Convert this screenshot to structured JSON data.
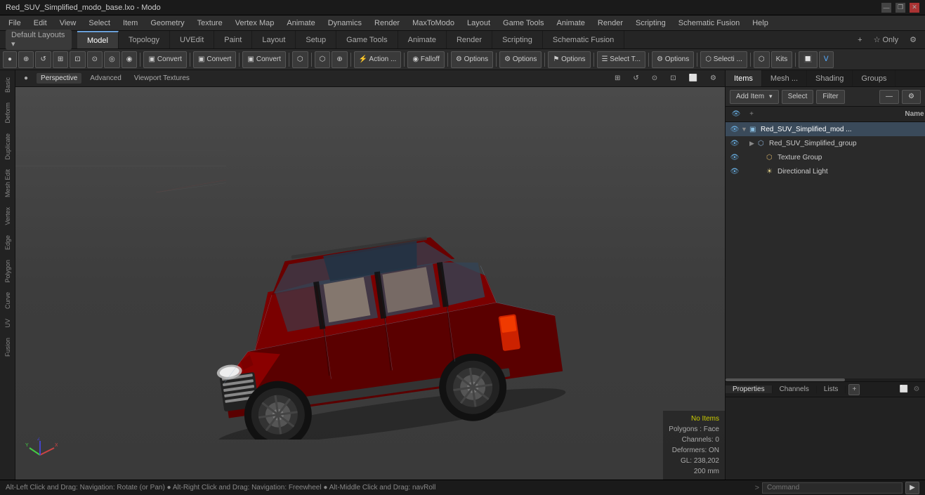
{
  "titlebar": {
    "title": "Red_SUV_Simplified_modo_base.lxo - Modo",
    "controls": [
      "—",
      "❐",
      "✕"
    ]
  },
  "menubar": {
    "items": [
      "File",
      "Edit",
      "View",
      "Select",
      "Item",
      "Geometry",
      "Texture",
      "Vertex Map",
      "Animate",
      "Dynamics",
      "Render",
      "MaxToModo",
      "Layout",
      "Game Tools",
      "Animate",
      "Render",
      "Scripting",
      "Schematic Fusion"
    ]
  },
  "tabbar": {
    "layout_label": "Default Layouts",
    "tabs": [
      "Model",
      "Topology",
      "UVEdit",
      "Paint",
      "Layout",
      "Setup",
      "Game Tools",
      "Animate",
      "Render",
      "Scripting",
      "Schematic Fusion"
    ],
    "active_tab": "Model",
    "right_buttons": [
      "+",
      "☆ Only",
      "⚙"
    ]
  },
  "toolbar2": {
    "tools": [
      {
        "label": "●",
        "type": "icon"
      },
      {
        "label": "⊕",
        "type": "icon"
      },
      {
        "label": "↺",
        "type": "icon"
      },
      {
        "label": "⊞",
        "type": "icon"
      },
      {
        "label": "⊡",
        "type": "icon"
      },
      {
        "label": "⊙",
        "type": "icon"
      },
      {
        "label": "◎",
        "type": "icon"
      },
      {
        "label": "◉",
        "type": "icon"
      },
      {
        "sep": true
      },
      {
        "label": "Convert",
        "type": "btn"
      },
      {
        "sep": true
      },
      {
        "label": "Convert",
        "type": "btn"
      },
      {
        "sep": true
      },
      {
        "label": "Convert",
        "type": "btn"
      },
      {
        "sep": true
      },
      {
        "label": "⬡",
        "type": "icon"
      },
      {
        "sep": true
      },
      {
        "label": "⬡",
        "type": "icon"
      },
      {
        "label": "⊕",
        "type": "icon"
      },
      {
        "sep": true
      },
      {
        "label": "⚡ Action ...",
        "type": "btn"
      },
      {
        "sep": true
      },
      {
        "label": "◉ Falloff",
        "type": "btn"
      },
      {
        "sep": true
      },
      {
        "label": "⚙ Options",
        "type": "btn"
      },
      {
        "sep": true
      },
      {
        "label": "⚙ Options",
        "type": "btn"
      },
      {
        "sep": true
      },
      {
        "label": "⚑ Options",
        "type": "btn"
      },
      {
        "sep": true
      },
      {
        "label": "☰ Select T...",
        "type": "btn"
      },
      {
        "sep": true
      },
      {
        "label": "⚙ Options",
        "type": "btn"
      },
      {
        "sep": true
      },
      {
        "label": "⬡ Selecti ...",
        "type": "btn"
      },
      {
        "sep": true
      },
      {
        "label": "⬡",
        "type": "icon"
      },
      {
        "label": "Kits",
        "type": "btn"
      },
      {
        "sep": true
      },
      {
        "label": "🔲",
        "type": "icon"
      },
      {
        "label": "Ⅴ",
        "type": "icon"
      }
    ]
  },
  "viewport": {
    "tabs": [
      "Perspective",
      "Advanced",
      "Viewport Textures"
    ],
    "active_tab": "Perspective",
    "status": {
      "no_items": "No Items",
      "polygons": "Polygons : Face",
      "channels": "Channels: 0",
      "deformers": "Deformers: ON",
      "gl": "GL: 238,202",
      "size": "200 mm"
    }
  },
  "left_sidebar": {
    "items": [
      "Basic",
      "Deform",
      "Duplicate",
      "Mesh Edit",
      "Vertex",
      "Edge",
      "Polygon",
      "Curve",
      "UV",
      "Fusion"
    ]
  },
  "right_panel": {
    "tabs": [
      "Items",
      "Mesh ...",
      "Shading",
      "Groups"
    ],
    "active_tab": "Items",
    "toolbar": {
      "add_item": "Add Item",
      "select": "Select",
      "filter": "Filter"
    },
    "items_header": {
      "name_col": "Name"
    },
    "items": [
      {
        "id": 1,
        "level": 0,
        "name": "Red_SUV_Simplified_mod ...",
        "icon": "mesh",
        "visible": true,
        "expanded": true,
        "selected": true
      },
      {
        "id": 2,
        "level": 1,
        "name": "Red_SUV_Simplified_group",
        "icon": "group",
        "visible": true,
        "expanded": false
      },
      {
        "id": 3,
        "level": 2,
        "name": "Texture Group",
        "icon": "texture",
        "visible": true,
        "expanded": false
      },
      {
        "id": 4,
        "level": 2,
        "name": "Directional Light",
        "icon": "light",
        "visible": true,
        "expanded": false
      }
    ]
  },
  "properties_panel": {
    "tabs": [
      "Properties",
      "Channels",
      "Lists"
    ],
    "active_tab": "Properties",
    "add_btn": "+",
    "content": ""
  },
  "statusbar": {
    "text": "Alt-Left Click and Drag: Navigation: Rotate (or Pan) ● Alt-Right Click and Drag: Navigation: Freewheel ● Alt-Middle Click and Drag: navRoll",
    "arrow": ">",
    "command_placeholder": "Command"
  }
}
